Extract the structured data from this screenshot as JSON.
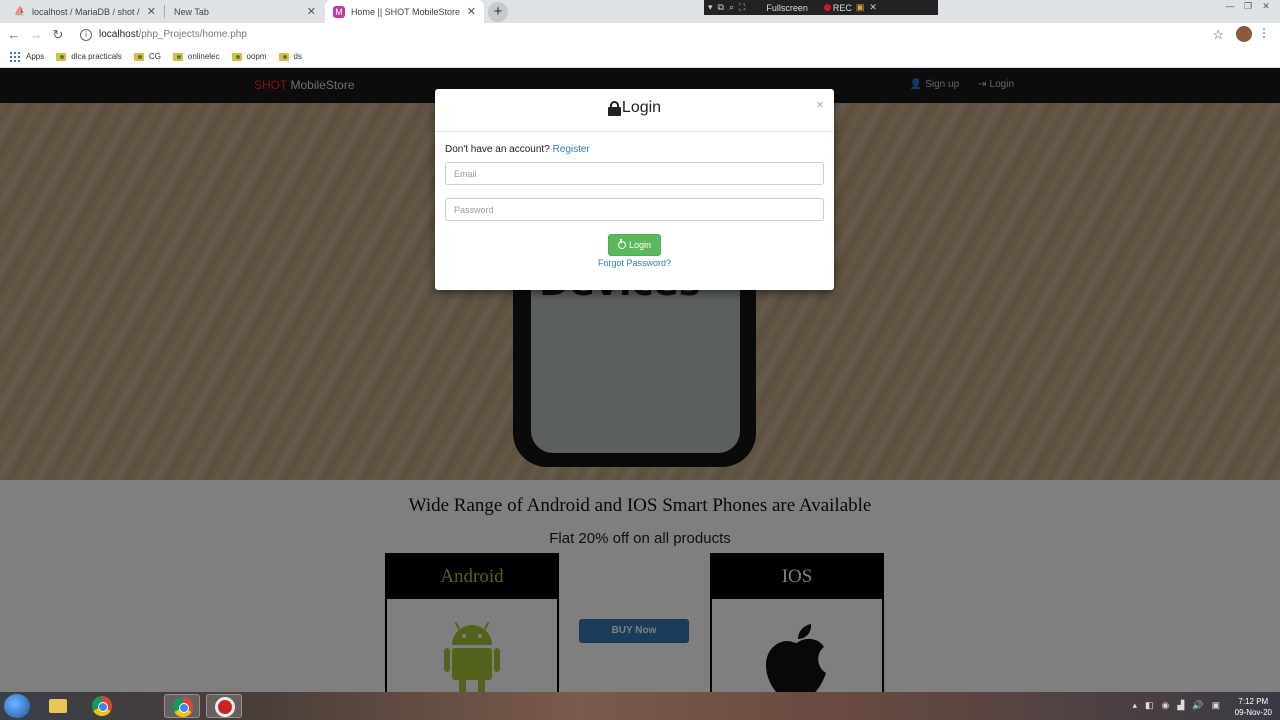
{
  "browser": {
    "tabs": [
      {
        "label": "localhost / MariaDB / shot / item",
        "active": false
      },
      {
        "label": "New Tab",
        "active": false
      },
      {
        "label": "Home || SHOT MobileStore",
        "active": true
      }
    ],
    "recorder": {
      "fullscreen_label": "Fullscreen",
      "rec_label": "REC"
    },
    "address": {
      "host": "localhost",
      "path": "/php_Projects/home.php"
    },
    "bookmarks": [
      "Apps",
      "dlca practicals",
      "CG",
      "onlinelec",
      "oopm",
      "ds"
    ]
  },
  "site": {
    "brand_prefix": "S",
    "brand_hot": "HOT",
    "brand_suffix": " MobileStore",
    "nav": {
      "signup": "Sign up",
      "login": "Login"
    },
    "hero_word": "Devices",
    "headline": "Wide Range of Android and IOS Smart Phones are Available",
    "offer": "Flat 20% off on all products",
    "cards": {
      "android": "Android",
      "ios": "IOS"
    },
    "buy_label": "BUY Now"
  },
  "modal": {
    "title": "Login",
    "close": "×",
    "account_text": "Don't have an account?",
    "register_link": "Register",
    "email_placeholder": "Email",
    "password_placeholder": "Password",
    "login_button": "Login",
    "forgot": "Forgot Password?"
  },
  "taskbar": {
    "time": "7:12 PM",
    "date": "09-Nov-20"
  },
  "colors": {
    "brand_hot": "#ff2222",
    "login_button": "#5cb85c",
    "buy_button": "#337ab7",
    "android_green": "#a4c639"
  }
}
